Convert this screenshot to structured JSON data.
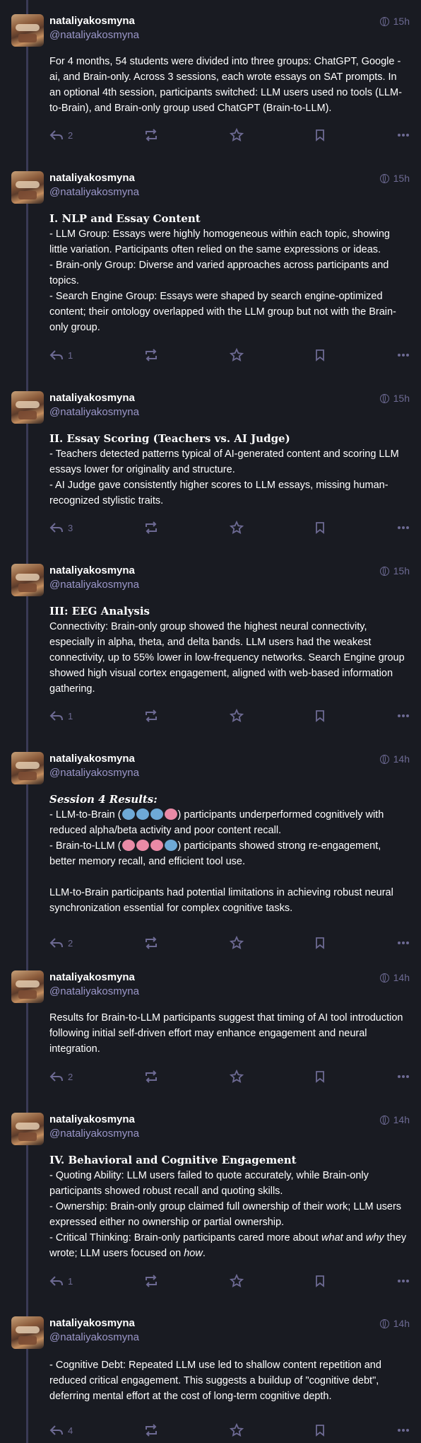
{
  "posts": [
    {
      "name": "nataliyakosmyna",
      "handle": "@nataliyakosmyna",
      "time": "15h",
      "replies": "2",
      "paragraphs": [
        "For 4 months, 54 students were divided into three groups: ChatGPT, Google -ai, and Brain-only. Across 3 sessions, each wrote essays on SAT prompts. In an optional 4th session, participants switched: LLM users used no tools (LLM-to-Brain), and Brain-only group used ChatGPT (Brain-to-LLM)."
      ]
    },
    {
      "name": "nataliyakosmyna",
      "handle": "@nataliyakosmyna",
      "time": "15h",
      "replies": "1",
      "title": "I. NLP and Essay Content",
      "paragraphs": [
        "- LLM Group: Essays were highly homogeneous within each topic, showing little variation. Participants often relied on the same expressions or ideas.",
        "- Brain-only Group: Diverse and varied approaches across participants and topics.",
        "- Search Engine Group: Essays were shaped by search engine-optimized content; their ontology overlapped with the LLM group but not with the Brain-only group."
      ]
    },
    {
      "name": "nataliyakosmyna",
      "handle": "@nataliyakosmyna",
      "time": "15h",
      "replies": "3",
      "title": "II. Essay Scoring (Teachers vs. AI Judge)",
      "paragraphs": [
        "- Teachers detected patterns typical of AI-generated content and scoring LLM essays lower for originality and structure.",
        "- AI Judge gave consistently higher scores to LLM essays, missing human-recognized stylistic traits."
      ]
    },
    {
      "name": "nataliyakosmyna",
      "handle": "@nataliyakosmyna",
      "time": "15h",
      "replies": "1",
      "title": "III: EEG Analysis",
      "paragraphs": [
        "Connectivity: Brain-only group showed the highest neural connectivity, especially in alpha, theta, and delta bands. LLM users had the weakest connectivity, up to 55% lower in low-frequency networks. Search Engine group showed high visual cortex engagement, aligned with web-based information gathering."
      ]
    },
    {
      "name": "nataliyakosmyna",
      "handle": "@nataliyakosmyna",
      "time": "14h",
      "replies": "2",
      "title": "Session 4 Results:",
      "line1a": "- LLM-to-Brain (",
      "line1b": ") participants underperformed cognitively with reduced alpha/beta activity and poor content recall.",
      "line2a": "- Brain-to-LLM (",
      "line2b": ") participants showed strong re-engagement, better memory recall, and efficient tool use.",
      "paragraphs": [
        "LLM-to-Brain participants had potential limitations in achieving robust neural synchronization essential for complex cognitive tasks."
      ]
    },
    {
      "name": "nataliyakosmyna",
      "handle": "@nataliyakosmyna",
      "time": "14h",
      "replies": "2",
      "paragraphs": [
        "Results for Brain-to-LLM participants suggest that timing of AI tool introduction following initial self-driven effort may enhance engagement and neural integration."
      ]
    },
    {
      "name": "nataliyakosmyna",
      "handle": "@nataliyakosmyna",
      "time": "14h",
      "replies": "1",
      "title": "IV. Behavioral and Cognitive Engagement",
      "paragraphs": [
        "- Quoting Ability: LLM users failed to quote accurately, while Brain-only participants showed robust recall and quoting skills.",
        "- Ownership: Brain-only group claimed full ownership of their work; LLM users expressed either no ownership or partial ownership."
      ],
      "ct_a": "- Critical Thinking: Brain-only participants cared more about ",
      "ct_what": "what",
      "ct_and": " and ",
      "ct_why": "why",
      "ct_b": " they wrote; LLM users focused on ",
      "ct_how": "how",
      "ct_end": "."
    },
    {
      "name": "nataliyakosmyna",
      "handle": "@nataliyakosmyna",
      "time": "14h",
      "replies": "4",
      "paragraphs": [
        "- Cognitive Debt: Repeated LLM use led to shallow content repetition and reduced critical engagement. This suggests a buildup of \"cognitive debt\", deferring mental effort at the cost of long-term cognitive depth."
      ]
    }
  ],
  "icons": {
    "reply": "reply-icon",
    "boost": "boost-icon",
    "favourite": "star-icon",
    "bookmark": "bookmark-icon",
    "more": "more-icon",
    "visibility": "globe-icon"
  },
  "colors": {
    "background": "#191b22",
    "handle": "#9b97c9",
    "muted": "#6d6a93",
    "thread_line": "#3a3a55"
  }
}
